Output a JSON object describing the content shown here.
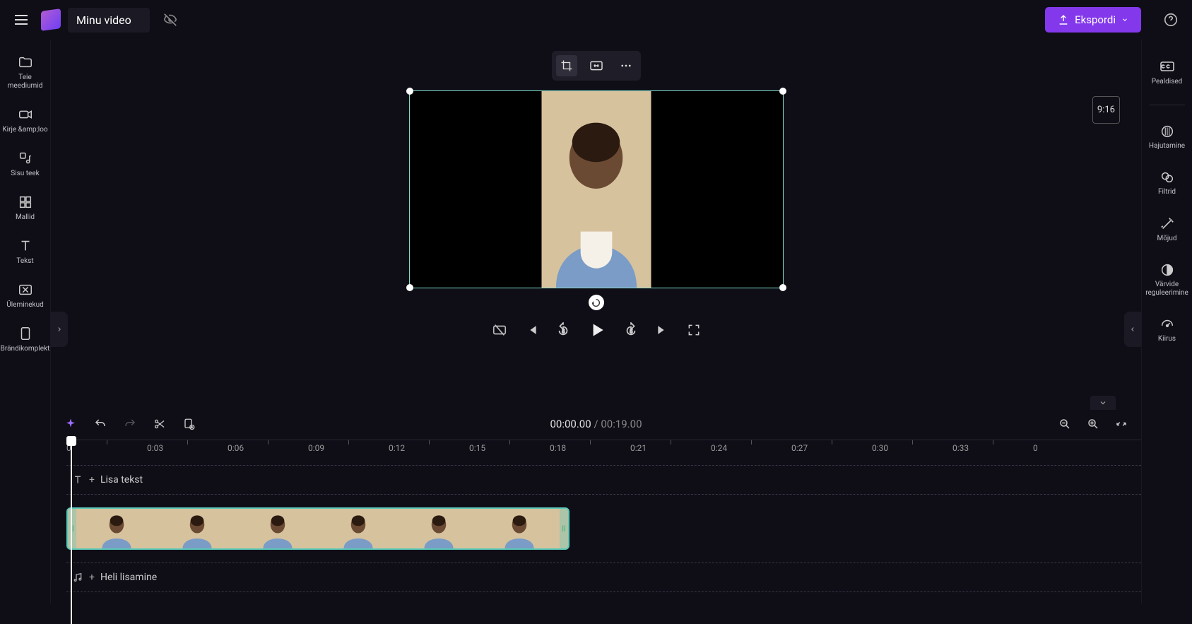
{
  "header": {
    "title": "Minu video",
    "export_label": "Ekspordi"
  },
  "left_sidebar": {
    "items": [
      {
        "label": "Teie meediumid"
      },
      {
        "label": "Kirje &amp;loo"
      },
      {
        "label": "Sisu teek"
      },
      {
        "label": "Mallid"
      },
      {
        "label": "Tekst"
      },
      {
        "label": "Üleminekud"
      },
      {
        "label": "Brändikomplekt"
      }
    ]
  },
  "right_sidebar": {
    "items": [
      {
        "label": "Pealdised"
      },
      {
        "label": "Hajutamine"
      },
      {
        "label": "Filtrid"
      },
      {
        "label": "Mõjud"
      },
      {
        "label": "Värvide reguleerimine"
      },
      {
        "label": "Kiirus"
      }
    ]
  },
  "preview": {
    "aspect_ratio": "9:16"
  },
  "timeline": {
    "current_time": "00:00.00",
    "total_time": "00:19.00",
    "ruler": [
      "0",
      "0:03",
      "0:06",
      "0:09",
      "0:12",
      "0:15",
      "0:18",
      "0:21",
      "0:24",
      "0:27",
      "0:30",
      "0:33",
      "0"
    ],
    "text_track_label": "Lisa tekst",
    "audio_track_label": "Heli lisamine"
  }
}
